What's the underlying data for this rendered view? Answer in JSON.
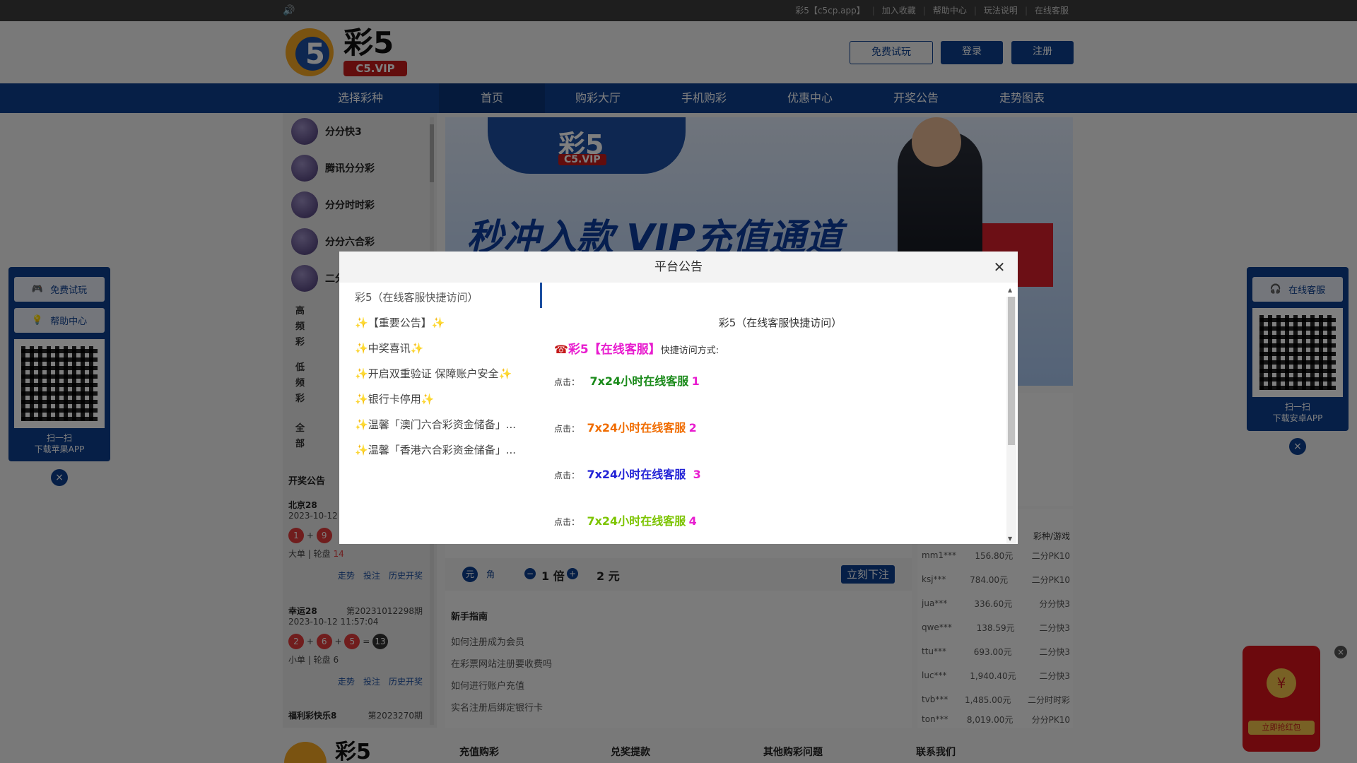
{
  "topbar": {
    "links": [
      "彩5【c5cp.app】",
      "加入收藏",
      "帮助中心",
      "玩法说明",
      "在线客服"
    ]
  },
  "header": {
    "logo_text": "彩5",
    "logo_sub": "C5.VIP",
    "btn_trial": "免费试玩",
    "btn_login": "登录",
    "btn_register": "注册"
  },
  "nav": {
    "items": [
      "选择彩种",
      "首页",
      "购彩大厅",
      "手机购彩",
      "优惠中心",
      "开奖公告",
      "走势图表"
    ]
  },
  "lotteries": [
    "分分快3",
    "腾讯分分彩",
    "分分时时彩",
    "分分六合彩",
    "二分"
  ],
  "categories": [
    "高频彩",
    "低频彩",
    "全部"
  ],
  "draws": {
    "heading": "开奖公告",
    "items": [
      {
        "name": "北京28",
        "date": "2023-10-12",
        "balls": [
          "1",
          "9"
        ],
        "sum_label": "大单 | 轮盘",
        "sum": "14"
      },
      {
        "name": "幸运28",
        "issue": "第20231012298期",
        "date": "2023-10-12 11:57:04",
        "balls": [
          "2",
          "6",
          "5"
        ],
        "result": "13",
        "sum_label": "小单 | 轮盘 6"
      },
      {
        "name": "福利彩快乐8",
        "issue": "第2023270期"
      }
    ],
    "links": [
      "走势",
      "投注",
      "历史开奖"
    ]
  },
  "banner": {
    "logo_text": "彩5",
    "logo_sub": "C5.VIP",
    "title": "秒冲入款 VIP充值通道"
  },
  "bet": {
    "unit_yuan": "元",
    "unit_jiao": "角",
    "multiple": "1 倍",
    "amount": "2 元",
    "submit": "立刻下注"
  },
  "guide": {
    "heading": "新手指南",
    "items": [
      "如何注册成为会员",
      "在彩票网站注册要收费吗",
      "如何进行账户充值",
      "实名注册后绑定银行卡"
    ]
  },
  "winners": {
    "header": "彩种/游戏",
    "rows": [
      {
        "user": "mm1***",
        "amount": "156.80元",
        "game": "二分PK10"
      },
      {
        "user": "ksj***",
        "amount": "784.00元",
        "game": "二分PK10"
      },
      {
        "user": "jua***",
        "amount": "336.60元",
        "game": "分分快3"
      },
      {
        "user": "qwe***",
        "amount": "138.59元",
        "game": "二分快3"
      },
      {
        "user": "ttu***",
        "amount": "693.00元",
        "game": "二分快3"
      },
      {
        "user": "luc***",
        "amount": "1,940.40元",
        "game": "二分快3"
      },
      {
        "user": "tvb***",
        "amount": "1,485.00元",
        "game": "二分时时彩"
      },
      {
        "user": "ton***",
        "amount": "8,019.00元",
        "game": "分分PK10"
      }
    ]
  },
  "footer": {
    "headings": [
      "充值购彩",
      "兑奖提款",
      "其他购彩问题",
      "联系我们"
    ]
  },
  "left_float": {
    "btn_trial": "免费试玩",
    "btn_help": "帮助中心",
    "caption1": "扫一扫",
    "caption2": "下载苹果APP"
  },
  "right_float": {
    "btn_service": "在线客服",
    "caption1": "扫一扫",
    "caption2": "下载安卓APP"
  },
  "redpack": {
    "label": "立即抢红包"
  },
  "modal": {
    "title": "平台公告",
    "list": [
      "彩5（在线客服快捷访问）",
      "【重要公告】",
      "中奖喜讯",
      "开启双重验证 保障账户安全",
      "银行卡停用",
      "温馨「澳门六合彩资金储备」...",
      "温馨「香港六合彩资金储备」..."
    ],
    "content_title": "彩5（在线客服快捷访问）",
    "intro_brand": "彩5【在线客服】",
    "intro_rest": "快捷访问方式:",
    "click_label": "点击：",
    "links": [
      {
        "text": "7x24小时在线客服",
        "num": "1",
        "color": "#1a8a1a"
      },
      {
        "text": "7x24小时在线客服",
        "num": "2",
        "color": "#f06c00"
      },
      {
        "text": "7x24小时在线客服",
        "num": "3",
        "color": "#2323d6"
      },
      {
        "text": "7x24小时在线客服",
        "num": "4",
        "color": "#7cc400"
      }
    ],
    "num_color": "#e81ccf",
    "brand_color": "#e81ccf"
  }
}
